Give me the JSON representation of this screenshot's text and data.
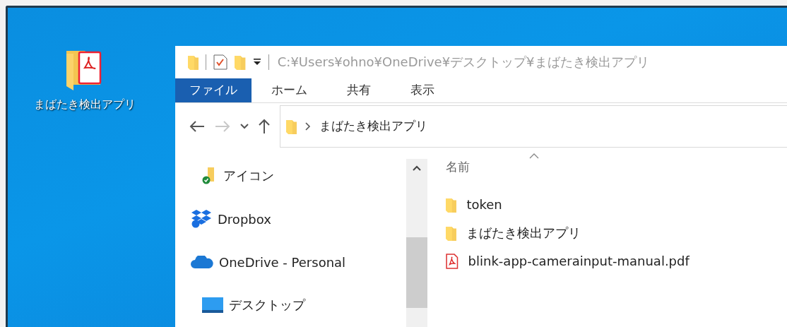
{
  "desktop_icon": {
    "label": "まばたき検出アプリ"
  },
  "explorer": {
    "title_path": "C:¥Users¥ohno¥OneDrive¥デスクトップ¥まばたき検出アプリ",
    "ribbon_tabs": [
      {
        "label": "ファイル",
        "selected": true
      },
      {
        "label": "ホーム",
        "selected": false
      },
      {
        "label": "共有",
        "selected": false
      },
      {
        "label": "表示",
        "selected": false
      }
    ],
    "address_crumbs": [
      "まばたき検出アプリ"
    ],
    "nav_items": [
      {
        "label": "アイコン",
        "kind": "synced-folder"
      },
      {
        "label": "Dropbox",
        "kind": "dropbox"
      },
      {
        "label": "OneDrive - Personal",
        "kind": "onedrive",
        "children": [
          {
            "label": "デスクトップ",
            "kind": "desktop"
          }
        ]
      }
    ],
    "columns": [
      {
        "label": "名前",
        "sorted": true
      }
    ],
    "files": [
      {
        "name": "token",
        "kind": "folder"
      },
      {
        "name": "まばたき検出アプリ",
        "kind": "folder"
      },
      {
        "name": "blink-app-camerainput-manual.pdf",
        "kind": "pdf"
      }
    ]
  }
}
